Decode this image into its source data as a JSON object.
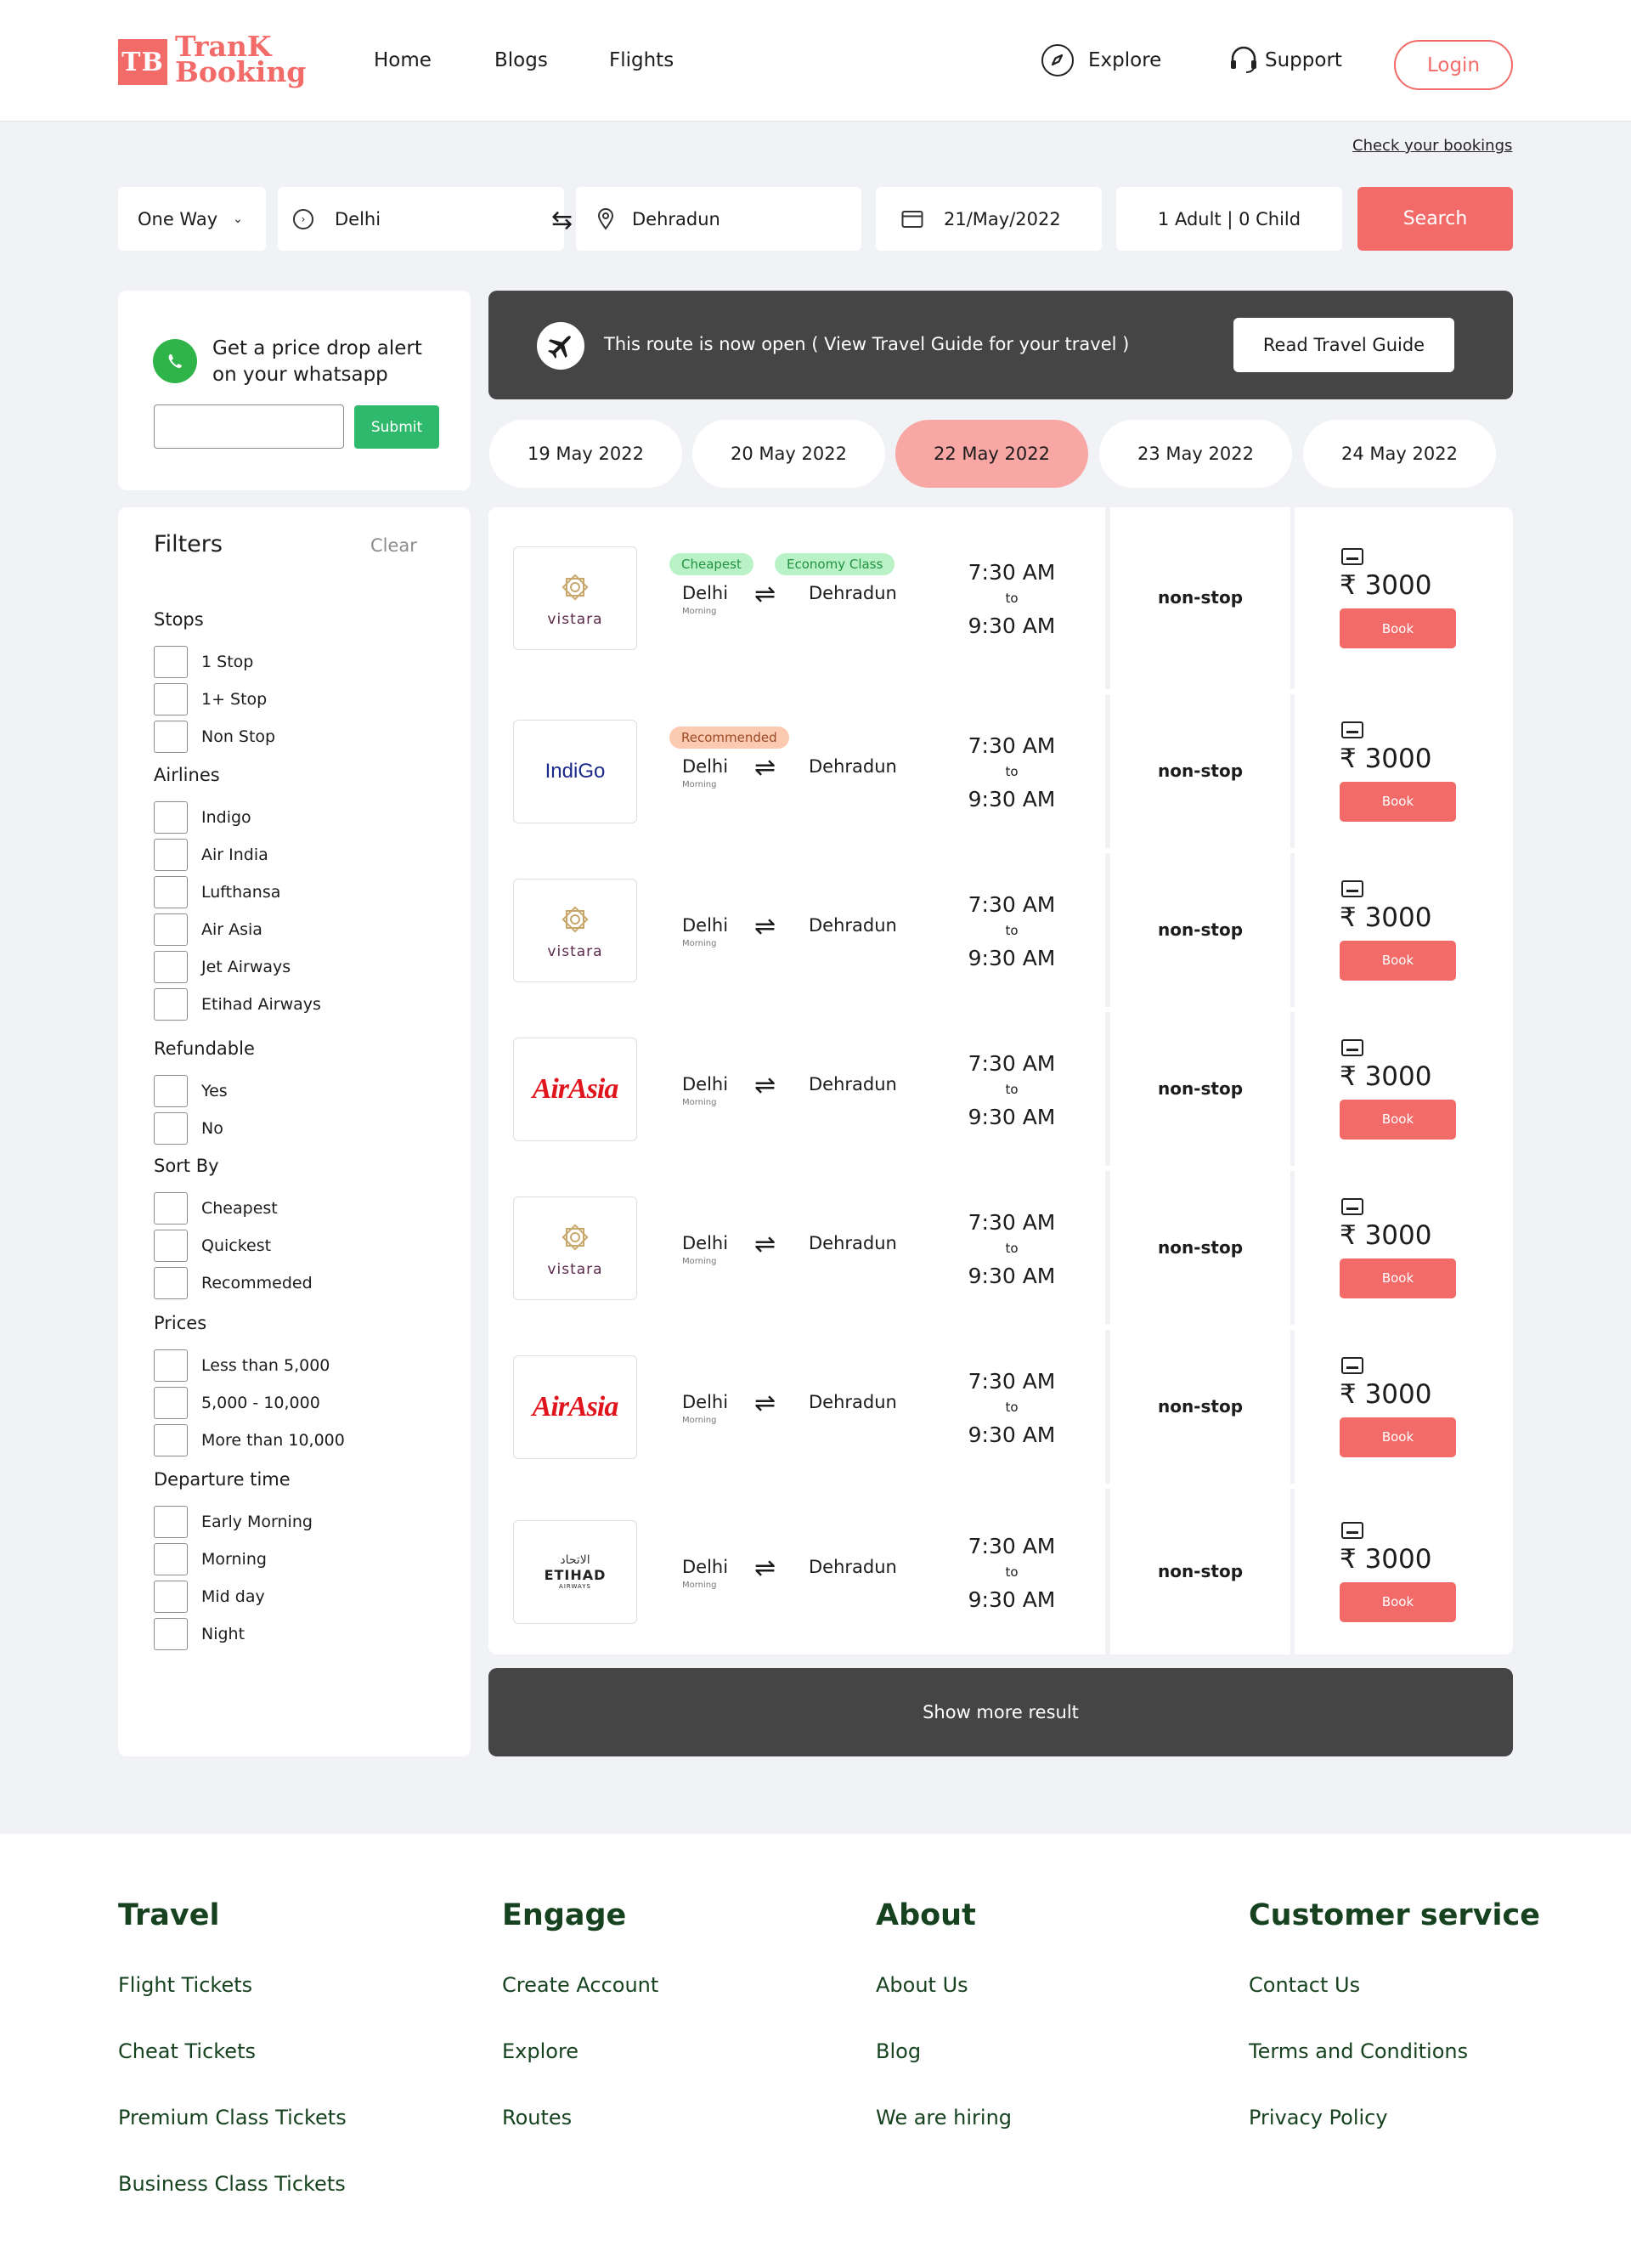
{
  "brand": {
    "mark": "TB",
    "name_line1": "TranK",
    "name_line2": "Booking",
    "accent": "#f26b68"
  },
  "nav": {
    "home": "Home",
    "blogs": "Blogs",
    "flights": "Flights",
    "explore": "Explore",
    "support": "Support",
    "login": "Login"
  },
  "check_bookings": "Check your bookings",
  "search": {
    "trip_type": "One Way",
    "from": "Delhi",
    "to": "Dehradun",
    "date": "21/May/2022",
    "travellers": "1 Adult | 0 Child",
    "button": "Search"
  },
  "alert": {
    "text": "Get a price drop alert on your whatsapp",
    "input_value": "",
    "submit": "Submit"
  },
  "filters": {
    "title": "Filters",
    "clear": "Clear",
    "groups": [
      {
        "name": "Stops",
        "options": [
          "1 Stop",
          "1+ Stop",
          "Non Stop"
        ]
      },
      {
        "name": "Airlines",
        "options": [
          "Indigo",
          "Air India",
          "Lufthansa",
          "Air Asia",
          "Jet Airways",
          "Etihad Airways"
        ]
      },
      {
        "name": "Refundable",
        "options": [
          "Yes",
          "No"
        ]
      },
      {
        "name": "Sort By",
        "options": [
          "Cheapest",
          "Quickest",
          "Recommeded"
        ]
      },
      {
        "name": "Prices",
        "options": [
          "Less than 5,000",
          "5,000 - 10,000",
          "More than 10,000"
        ]
      },
      {
        "name": "Departure time",
        "options": [
          "Early Morning",
          "Morning",
          "Mid day",
          "Night"
        ]
      }
    ]
  },
  "banner": {
    "text": "This route is now open ( View Travel Guide for your travel )",
    "button": "Read Travel Guide"
  },
  "dates": [
    "19 May 2022",
    "20 May 2022",
    "22 May 2022",
    "23 May 2022",
    "24 May 2022"
  ],
  "selected_date_index": 2,
  "flights": [
    {
      "airline": "vistara",
      "badges": [
        "Cheapest",
        "Economy Class"
      ],
      "from": "Delhi",
      "from_sub": "Morning",
      "to": "Dehradun",
      "depart": "7:30 AM",
      "to_word": "to",
      "arrive": "9:30 AM",
      "stops": "non-stop",
      "price": "₹ 3000",
      "book": "Book"
    },
    {
      "airline": "IndiGo",
      "badges": [
        "Recommended"
      ],
      "from": "Delhi",
      "from_sub": "Morning",
      "to": "Dehradun",
      "depart": "7:30 AM",
      "to_word": "to",
      "arrive": "9:30 AM",
      "stops": "non-stop",
      "price": "₹ 3000",
      "book": "Book"
    },
    {
      "airline": "vistara",
      "badges": [],
      "from": "Delhi",
      "from_sub": "Morning",
      "to": "Dehradun",
      "depart": "7:30 AM",
      "to_word": "to",
      "arrive": "9:30 AM",
      "stops": "non-stop",
      "price": "₹ 3000",
      "book": "Book"
    },
    {
      "airline": "AirAsia",
      "badges": [],
      "from": "Delhi",
      "from_sub": "Morning",
      "to": "Dehradun",
      "depart": "7:30 AM",
      "to_word": "to",
      "arrive": "9:30 AM",
      "stops": "non-stop",
      "price": "₹ 3000",
      "book": "Book"
    },
    {
      "airline": "vistara",
      "badges": [],
      "from": "Delhi",
      "from_sub": "Morning",
      "to": "Dehradun",
      "depart": "7:30 AM",
      "to_word": "to",
      "arrive": "9:30 AM",
      "stops": "non-stop",
      "price": "₹ 3000",
      "book": "Book"
    },
    {
      "airline": "AirAsia",
      "badges": [],
      "from": "Delhi",
      "from_sub": "Morning",
      "to": "Dehradun",
      "depart": "7:30 AM",
      "to_word": "to",
      "arrive": "9:30 AM",
      "stops": "non-stop",
      "price": "₹ 3000",
      "book": "Book"
    },
    {
      "airline": "ETIHAD",
      "airline_sub": "AIRWAYS",
      "airline_ar": "الاتحاد",
      "badges": [],
      "from": "Delhi",
      "from_sub": "Morning",
      "to": "Dehradun",
      "depart": "7:30 AM",
      "to_word": "to",
      "arrive": "9:30 AM",
      "stops": "non-stop",
      "price": "₹ 3000",
      "book": "Book"
    }
  ],
  "show_more": "Show more result",
  "footer": [
    {
      "heading": "Travel",
      "links": [
        "Flight Tickets",
        "Cheat Tickets",
        "Premium Class Tickets",
        "Business Class Tickets"
      ]
    },
    {
      "heading": "Engage",
      "links": [
        "Create Account",
        "Explore",
        "Routes"
      ]
    },
    {
      "heading": "About",
      "links": [
        "About Us",
        "Blog",
        "We are hiring"
      ]
    },
    {
      "heading": "Customer service",
      "links": [
        "Contact Us",
        "Terms and Conditions",
        "Privacy Policy"
      ]
    }
  ]
}
